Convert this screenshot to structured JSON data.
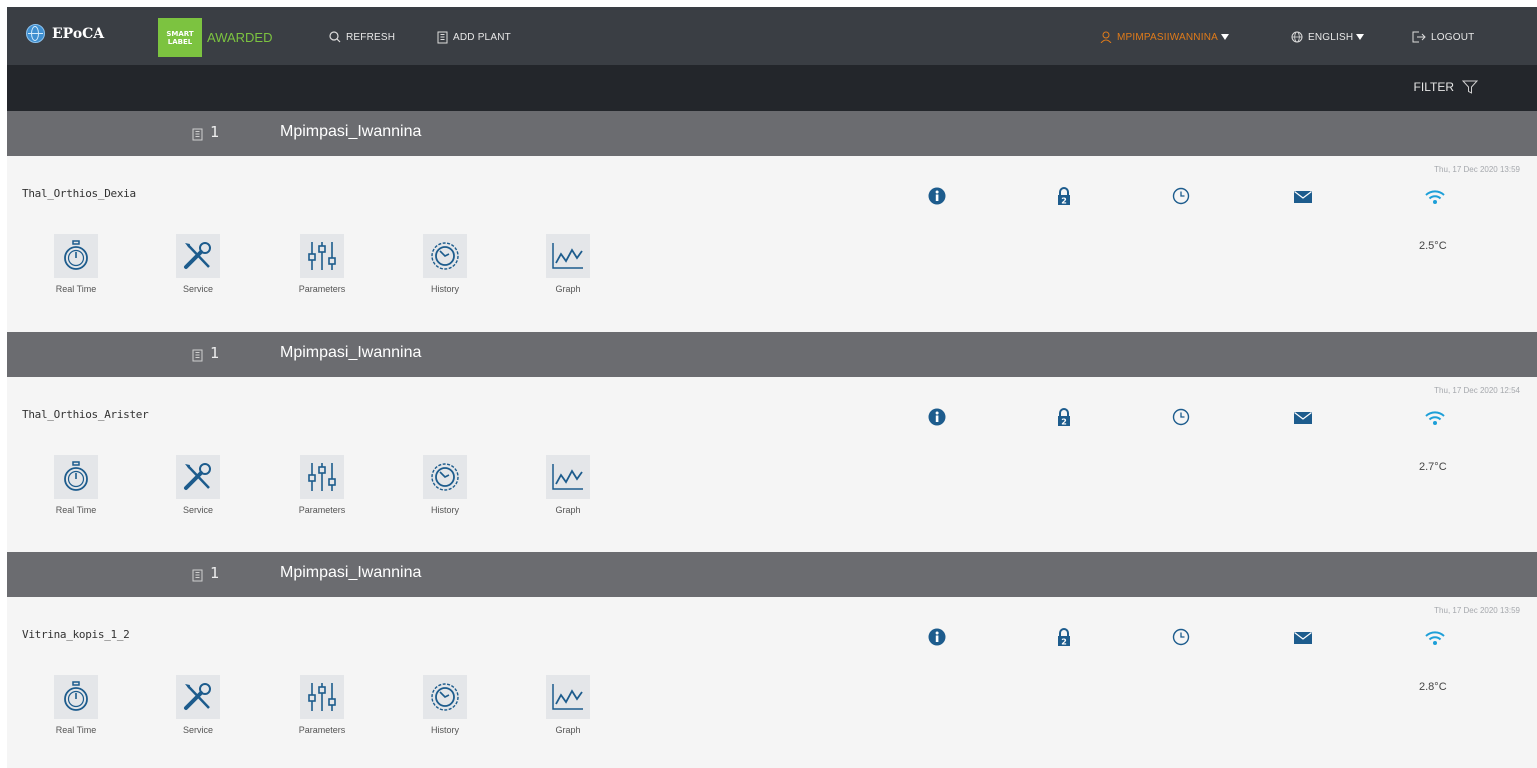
{
  "header": {
    "brand": "EPoCA",
    "badge_line1": "SMART",
    "badge_line2": "LABEL",
    "badge_awarded": "AWARDED",
    "refresh_label": "REFRESH",
    "add_plant_label": "ADD PLANT",
    "username": "MPIMPASIIWANNINA",
    "language": "ENGLISH",
    "logout_label": "LOGOUT"
  },
  "filterbar": {
    "filter_label": "FILTER"
  },
  "colors": {
    "topbar": "#3a3e44",
    "filterbar": "#23262b",
    "group_header": "#6b6c70",
    "accent_green": "#7cc340",
    "accent_orange": "#e07b1a",
    "icon_blue": "#1d5c8d"
  },
  "actions": [
    {
      "label": "Real Time",
      "icon": "stopwatch-icon"
    },
    {
      "label": "Service",
      "icon": "tools-icon"
    },
    {
      "label": "Parameters",
      "icon": "sliders-icon"
    },
    {
      "label": "History",
      "icon": "history-icon"
    },
    {
      "label": "Graph",
      "icon": "graph-icon"
    }
  ],
  "status_icons": [
    "info-icon",
    "lock-icon",
    "clock-icon",
    "mail-icon"
  ],
  "lock_badge": "2",
  "groups": [
    {
      "count": "1",
      "name": "Mpimpasi_Iwannina",
      "device": {
        "name": "Thal_Orthios_Dexia",
        "timestamp": "Thu, 17 Dec 2020 13:59",
        "temperature": "2.5°C"
      }
    },
    {
      "count": "1",
      "name": "Mpimpasi_Iwannina",
      "device": {
        "name": "Thal_Orthios_Arister",
        "timestamp": "Thu, 17 Dec 2020 12:54",
        "temperature": "2.7°C"
      }
    },
    {
      "count": "1",
      "name": "Mpimpasi_Iwannina",
      "device": {
        "name": "Vitrina_kopis_1_2",
        "timestamp": "Thu, 17 Dec 2020 13:59",
        "temperature": "2.8°C"
      }
    }
  ]
}
